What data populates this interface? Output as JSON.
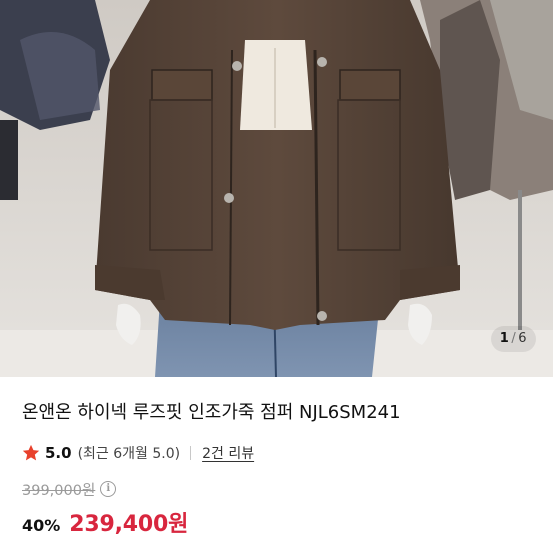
{
  "image": {
    "alt": "",
    "page_current": "1",
    "page_separator": "/",
    "page_total": "6"
  },
  "product": {
    "title": "온앤온 하이넥 루즈핏 인조가죽 점퍼 NJL6SM241"
  },
  "rating": {
    "star_icon": "star-icon",
    "score": "5.0",
    "recent": "(최근 6개월 5.0)",
    "review_link": "2건 리뷰"
  },
  "price": {
    "original": "399,000원",
    "info_icon": "info-icon",
    "discount": "40%",
    "sale": "239,400원"
  },
  "colors": {
    "accent_red": "#d8263e",
    "star": "#e8412c",
    "muted": "#9a9a9a"
  }
}
